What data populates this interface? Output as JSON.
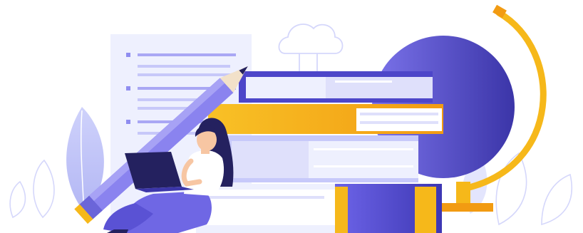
{
  "illustration": {
    "subject": "education-study-illustration",
    "colors": {
      "primary_purple": "#5a4fd6",
      "dark_navy": "#24215f",
      "light_lavender": "#dfe0fb",
      "pale_lavender": "#eef0fe",
      "accent_yellow": "#f6b81a",
      "accent_orange": "#f39a12",
      "skin": "#f7c6a3",
      "white": "#ffffff"
    },
    "icons": [
      "document-icon",
      "pencil-icon",
      "cloud-icon",
      "globe-icon",
      "book-stack-icon",
      "laptop-icon",
      "person-icon",
      "leaf-icon"
    ]
  }
}
